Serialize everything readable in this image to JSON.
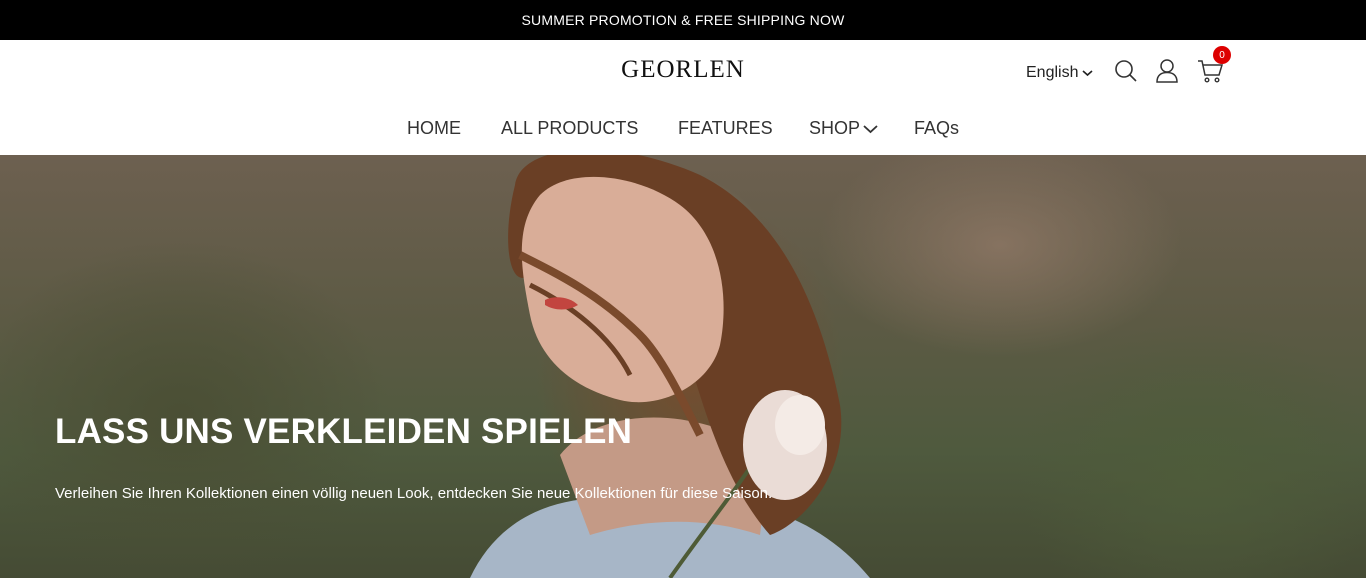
{
  "promo": {
    "text": "SUMMER PROMOTION & FREE SHIPPING NOW"
  },
  "header": {
    "logo": "GEORLEN",
    "language": "English",
    "cart_count": "0"
  },
  "nav": {
    "items": [
      {
        "label": "HOME"
      },
      {
        "label": "ALL PRODUCTS"
      },
      {
        "label": "FEATURES"
      },
      {
        "label": "SHOP"
      },
      {
        "label": "FAQs"
      }
    ]
  },
  "hero": {
    "title": "LASS UNS VERKLEIDEN SPIELEN",
    "subtitle": "Verleihen Sie Ihren Kollektionen einen völlig neuen Look, entdecken Sie neue Kollektionen für diese Saison."
  },
  "icons": {
    "search": "search-icon",
    "account": "user-icon",
    "cart": "cart-icon",
    "chevron": "chevron-down-icon"
  },
  "colors": {
    "promo_bg": "#000000",
    "badge": "#dd0000",
    "text": "#222222"
  }
}
